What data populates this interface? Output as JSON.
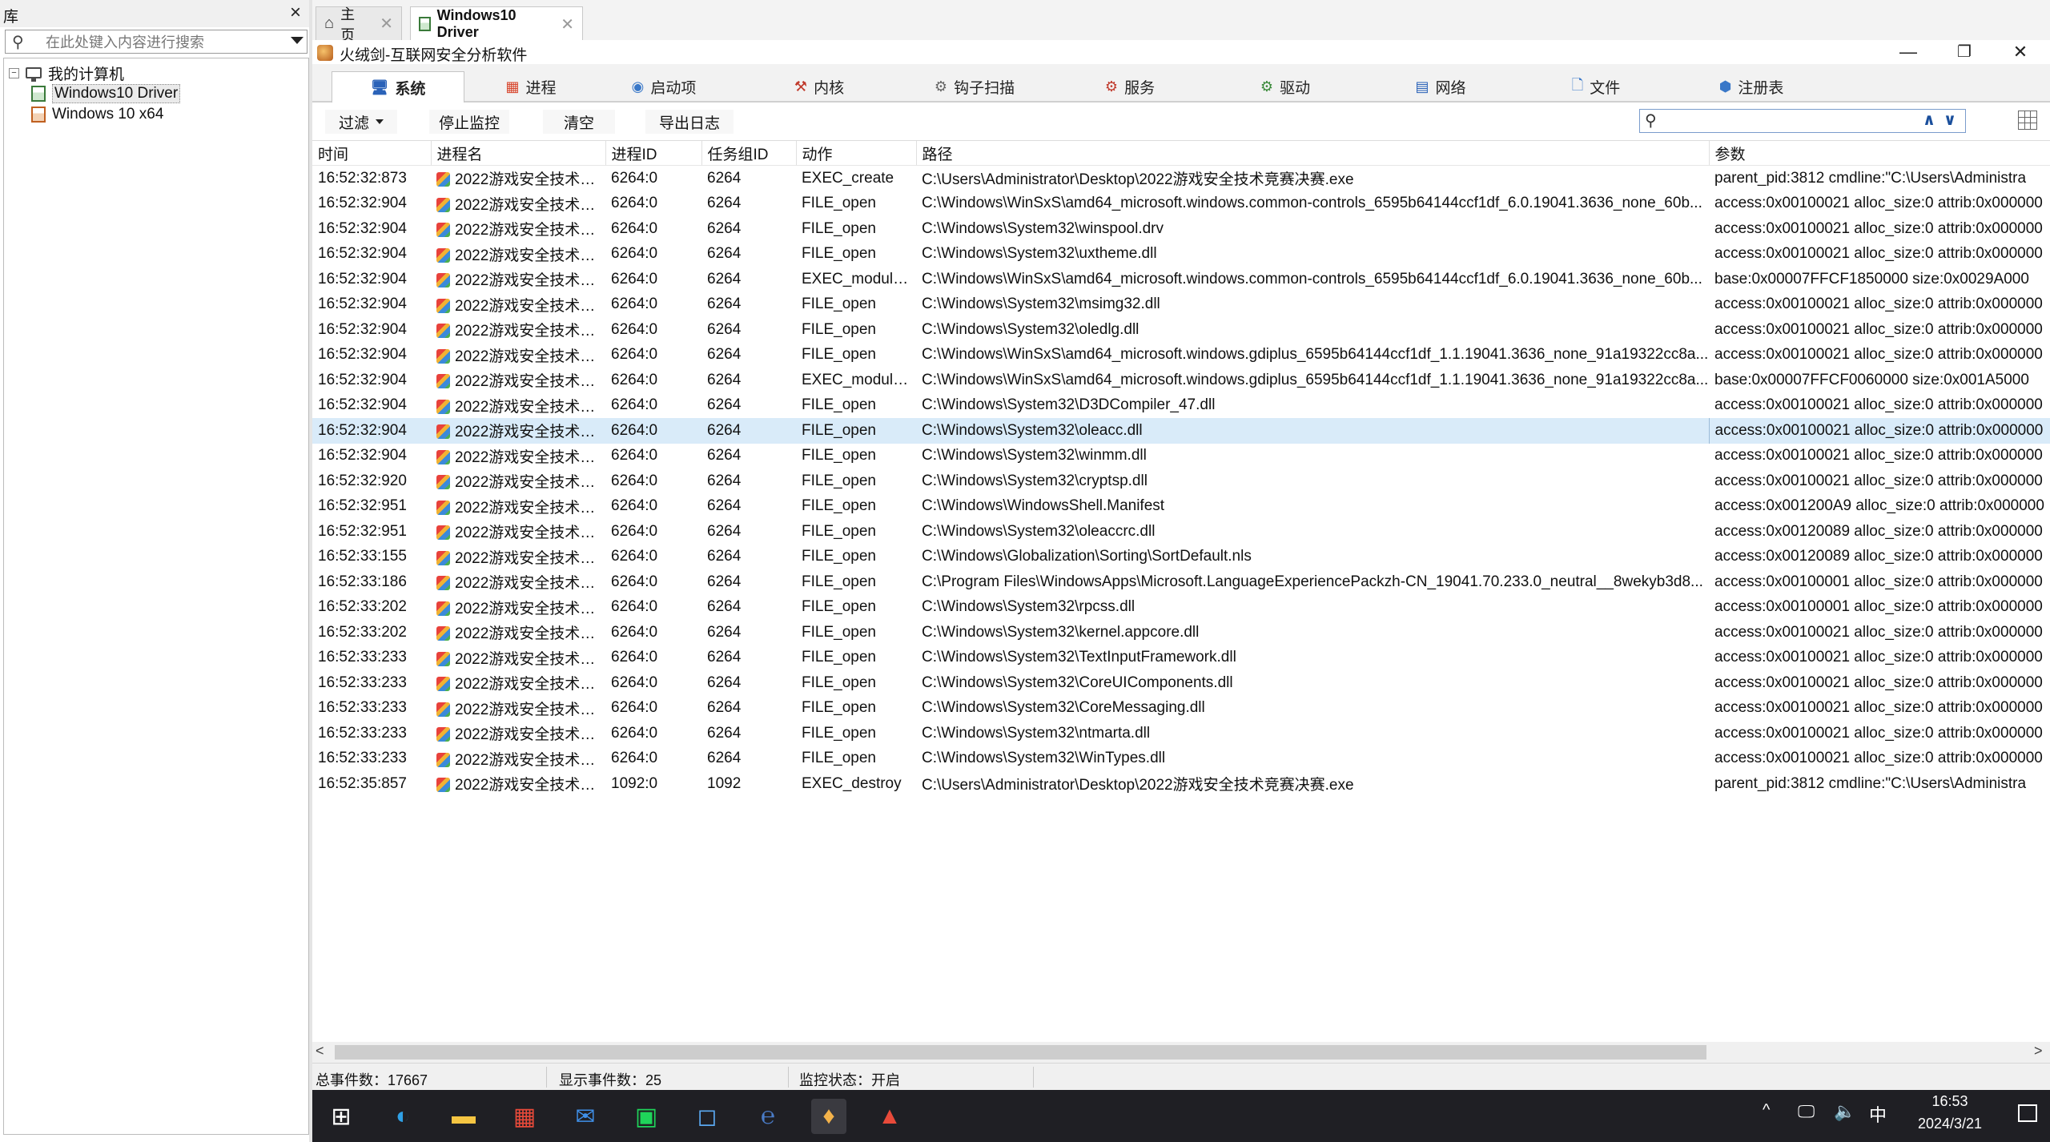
{
  "library": {
    "title": "库",
    "close_glyph": "×",
    "search_placeholder": "在此处键入内容进行搜索",
    "tree": {
      "root": {
        "label": "我的计算机",
        "expander": "−"
      },
      "children": [
        {
          "label": "Windows10 Driver",
          "selected": true
        },
        {
          "label": "Windows 10 x64",
          "selected": false
        }
      ]
    }
  },
  "doc_tabs": [
    {
      "label": "主页",
      "active": false
    },
    {
      "label": "Windows10 Driver",
      "active": true
    }
  ],
  "app": {
    "title": "火绒剑-互联网安全分析软件",
    "minimize": "—",
    "restore": "❐",
    "close": "✕"
  },
  "module_tabs": [
    {
      "label": "系统",
      "icon": "monitor-icon",
      "glyph": "🖥",
      "active": true
    },
    {
      "label": "进程",
      "icon": "process-icon",
      "glyph": "▦",
      "active": false
    },
    {
      "label": "启动项",
      "icon": "startup-icon",
      "glyph": "◉",
      "active": false
    },
    {
      "label": "内核",
      "icon": "kernel-icon",
      "glyph": "⚒",
      "active": false
    },
    {
      "label": "钩子扫描",
      "icon": "hook-icon",
      "glyph": "⚙",
      "active": false
    },
    {
      "label": "服务",
      "icon": "service-icon",
      "glyph": "⚙",
      "active": false
    },
    {
      "label": "驱动",
      "icon": "driver-icon",
      "glyph": "⚙",
      "active": false
    },
    {
      "label": "网络",
      "icon": "network-icon",
      "glyph": "▤",
      "active": false
    },
    {
      "label": "文件",
      "icon": "file-icon",
      "glyph": "🗋",
      "active": false
    },
    {
      "label": "注册表",
      "icon": "registry-icon",
      "glyph": "⬢",
      "active": false
    }
  ],
  "toolbar": {
    "filter": "过滤",
    "stop_monitor": "停止监控",
    "clear": "清空",
    "export_log": "导出日志",
    "search_value": ""
  },
  "table": {
    "columns": [
      "时间",
      "进程名",
      "进程ID",
      "任务组ID",
      "动作",
      "路径",
      "参数"
    ],
    "rows": [
      {
        "time": "16:52:32:873",
        "proc": "2022游戏安全技术竞...",
        "pid": "6264:0",
        "tgid": "6264",
        "action": "EXEC_create",
        "path": "C:\\Users\\Administrator\\Desktop\\2022游戏安全技术竞赛决赛.exe",
        "args": "parent_pid:3812 cmdline:\"C:\\Users\\Administra"
      },
      {
        "time": "16:52:32:904",
        "proc": "2022游戏安全技术竞...",
        "pid": "6264:0",
        "tgid": "6264",
        "action": "FILE_open",
        "path": "C:\\Windows\\WinSxS\\amd64_microsoft.windows.common-controls_6595b64144ccf1df_6.0.19041.3636_none_60b...",
        "args": "access:0x00100021 alloc_size:0 attrib:0x000000"
      },
      {
        "time": "16:52:32:904",
        "proc": "2022游戏安全技术竞...",
        "pid": "6264:0",
        "tgid": "6264",
        "action": "FILE_open",
        "path": "C:\\Windows\\System32\\winspool.drv",
        "args": "access:0x00100021 alloc_size:0 attrib:0x000000"
      },
      {
        "time": "16:52:32:904",
        "proc": "2022游戏安全技术竞...",
        "pid": "6264:0",
        "tgid": "6264",
        "action": "FILE_open",
        "path": "C:\\Windows\\System32\\uxtheme.dll",
        "args": "access:0x00100021 alloc_size:0 attrib:0x000000"
      },
      {
        "time": "16:52:32:904",
        "proc": "2022游戏安全技术竞...",
        "pid": "6264:0",
        "tgid": "6264",
        "action": "EXEC_module_...",
        "path": "C:\\Windows\\WinSxS\\amd64_microsoft.windows.common-controls_6595b64144ccf1df_6.0.19041.3636_none_60b...",
        "args": "base:0x00007FFCF1850000 size:0x0029A000"
      },
      {
        "time": "16:52:32:904",
        "proc": "2022游戏安全技术竞...",
        "pid": "6264:0",
        "tgid": "6264",
        "action": "FILE_open",
        "path": "C:\\Windows\\System32\\msimg32.dll",
        "args": "access:0x00100021 alloc_size:0 attrib:0x000000"
      },
      {
        "time": "16:52:32:904",
        "proc": "2022游戏安全技术竞...",
        "pid": "6264:0",
        "tgid": "6264",
        "action": "FILE_open",
        "path": "C:\\Windows\\System32\\oledlg.dll",
        "args": "access:0x00100021 alloc_size:0 attrib:0x000000"
      },
      {
        "time": "16:52:32:904",
        "proc": "2022游戏安全技术竞...",
        "pid": "6264:0",
        "tgid": "6264",
        "action": "FILE_open",
        "path": "C:\\Windows\\WinSxS\\amd64_microsoft.windows.gdiplus_6595b64144ccf1df_1.1.19041.3636_none_91a19322cc8a...",
        "args": "access:0x00100021 alloc_size:0 attrib:0x000000"
      },
      {
        "time": "16:52:32:904",
        "proc": "2022游戏安全技术竞...",
        "pid": "6264:0",
        "tgid": "6264",
        "action": "EXEC_module_...",
        "path": "C:\\Windows\\WinSxS\\amd64_microsoft.windows.gdiplus_6595b64144ccf1df_1.1.19041.3636_none_91a19322cc8a...",
        "args": "base:0x00007FFCF0060000 size:0x001A5000"
      },
      {
        "time": "16:52:32:904",
        "proc": "2022游戏安全技术竞...",
        "pid": "6264:0",
        "tgid": "6264",
        "action": "FILE_open",
        "path": "C:\\Windows\\System32\\D3DCompiler_47.dll",
        "args": "access:0x00100021 alloc_size:0 attrib:0x000000"
      },
      {
        "time": "16:52:32:904",
        "proc": "2022游戏安全技术竞...",
        "pid": "6264:0",
        "tgid": "6264",
        "action": "FILE_open",
        "path": "C:\\Windows\\System32\\oleacc.dll",
        "args": "access:0x00100021 alloc_size:0 attrib:0x000000",
        "selected": true
      },
      {
        "time": "16:52:32:904",
        "proc": "2022游戏安全技术竞...",
        "pid": "6264:0",
        "tgid": "6264",
        "action": "FILE_open",
        "path": "C:\\Windows\\System32\\winmm.dll",
        "args": "access:0x00100021 alloc_size:0 attrib:0x000000"
      },
      {
        "time": "16:52:32:920",
        "proc": "2022游戏安全技术竞...",
        "pid": "6264:0",
        "tgid": "6264",
        "action": "FILE_open",
        "path": "C:\\Windows\\System32\\cryptsp.dll",
        "args": "access:0x00100021 alloc_size:0 attrib:0x000000"
      },
      {
        "time": "16:52:32:951",
        "proc": "2022游戏安全技术竞...",
        "pid": "6264:0",
        "tgid": "6264",
        "action": "FILE_open",
        "path": "C:\\Windows\\WindowsShell.Manifest",
        "args": "access:0x001200A9 alloc_size:0 attrib:0x000000"
      },
      {
        "time": "16:52:32:951",
        "proc": "2022游戏安全技术竞...",
        "pid": "6264:0",
        "tgid": "6264",
        "action": "FILE_open",
        "path": "C:\\Windows\\System32\\oleaccrc.dll",
        "args": "access:0x00120089 alloc_size:0 attrib:0x000000"
      },
      {
        "time": "16:52:33:155",
        "proc": "2022游戏安全技术竞...",
        "pid": "6264:0",
        "tgid": "6264",
        "action": "FILE_open",
        "path": "C:\\Windows\\Globalization\\Sorting\\SortDefault.nls",
        "args": "access:0x00120089 alloc_size:0 attrib:0x000000"
      },
      {
        "time": "16:52:33:186",
        "proc": "2022游戏安全技术竞...",
        "pid": "6264:0",
        "tgid": "6264",
        "action": "FILE_open",
        "path": "C:\\Program Files\\WindowsApps\\Microsoft.LanguageExperiencePackzh-CN_19041.70.233.0_neutral__8wekyb3d8...",
        "args": "access:0x00100001 alloc_size:0 attrib:0x000000"
      },
      {
        "time": "16:52:33:202",
        "proc": "2022游戏安全技术竞...",
        "pid": "6264:0",
        "tgid": "6264",
        "action": "FILE_open",
        "path": "C:\\Windows\\System32\\rpcss.dll",
        "args": "access:0x00100001 alloc_size:0 attrib:0x000000"
      },
      {
        "time": "16:52:33:202",
        "proc": "2022游戏安全技术竞...",
        "pid": "6264:0",
        "tgid": "6264",
        "action": "FILE_open",
        "path": "C:\\Windows\\System32\\kernel.appcore.dll",
        "args": "access:0x00100021 alloc_size:0 attrib:0x000000"
      },
      {
        "time": "16:52:33:233",
        "proc": "2022游戏安全技术竞...",
        "pid": "6264:0",
        "tgid": "6264",
        "action": "FILE_open",
        "path": "C:\\Windows\\System32\\TextInputFramework.dll",
        "args": "access:0x00100021 alloc_size:0 attrib:0x000000"
      },
      {
        "time": "16:52:33:233",
        "proc": "2022游戏安全技术竞...",
        "pid": "6264:0",
        "tgid": "6264",
        "action": "FILE_open",
        "path": "C:\\Windows\\System32\\CoreUIComponents.dll",
        "args": "access:0x00100021 alloc_size:0 attrib:0x000000"
      },
      {
        "time": "16:52:33:233",
        "proc": "2022游戏安全技术竞...",
        "pid": "6264:0",
        "tgid": "6264",
        "action": "FILE_open",
        "path": "C:\\Windows\\System32\\CoreMessaging.dll",
        "args": "access:0x00100021 alloc_size:0 attrib:0x000000"
      },
      {
        "time": "16:52:33:233",
        "proc": "2022游戏安全技术竞...",
        "pid": "6264:0",
        "tgid": "6264",
        "action": "FILE_open",
        "path": "C:\\Windows\\System32\\ntmarta.dll",
        "args": "access:0x00100021 alloc_size:0 attrib:0x000000"
      },
      {
        "time": "16:52:33:233",
        "proc": "2022游戏安全技术竞...",
        "pid": "6264:0",
        "tgid": "6264",
        "action": "FILE_open",
        "path": "C:\\Windows\\System32\\WinTypes.dll",
        "args": "access:0x00100021 alloc_size:0 attrib:0x000000"
      },
      {
        "time": "16:52:35:857",
        "proc": "2022游戏安全技术竞...",
        "pid": "1092:0",
        "tgid": "1092",
        "action": "EXEC_destroy",
        "path": "C:\\Users\\Administrator\\Desktop\\2022游戏安全技术竞赛决赛.exe",
        "args": "parent_pid:3812 cmdline:\"C:\\Users\\Administra"
      }
    ]
  },
  "scrollbar": {
    "left_arrow": "<",
    "right_arrow": ">"
  },
  "status": {
    "total": "总事件数：17667",
    "shown": "显示事件数：25",
    "monitor": "监控状态：开启"
  },
  "taskbar": {
    "apps": [
      {
        "icon": "start-icon",
        "glyph": "⊞",
        "color": "#ffffff",
        "active": false
      },
      {
        "icon": "edge-icon",
        "glyph": "◐",
        "color": "#2fa0e6",
        "active": false
      },
      {
        "icon": "explorer-icon",
        "glyph": "▬",
        "color": "#f5c542",
        "active": false
      },
      {
        "icon": "store-icon",
        "glyph": "▦",
        "color": "#e84a3a",
        "active": false
      },
      {
        "icon": "mail-icon",
        "glyph": "✉",
        "color": "#3f8fe8",
        "active": false
      },
      {
        "icon": "terminal-icon",
        "glyph": "▣",
        "color": "#1fd45a",
        "active": false
      },
      {
        "icon": "window-app-icon",
        "glyph": "◻",
        "color": "#5aa8f0",
        "active": false
      },
      {
        "icon": "ce-icon",
        "glyph": "℮",
        "color": "#4a7cc8",
        "active": false
      },
      {
        "icon": "huorong-icon",
        "glyph": "♦",
        "color": "#f3b24a",
        "active": true
      },
      {
        "icon": "game-exe-icon",
        "glyph": "▲",
        "color": "#e84a3a",
        "active": false
      }
    ],
    "tray": {
      "chevron": "^",
      "network": "🖵",
      "volume": "🔈",
      "ime": "中"
    },
    "clock_time": "16:53",
    "clock_date": "2024/3/21"
  }
}
